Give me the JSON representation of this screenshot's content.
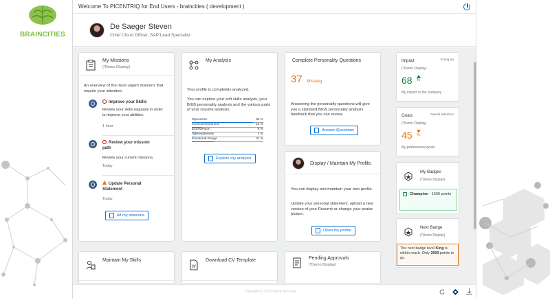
{
  "app": {
    "title": "Welcome To PICENTRIQ for End Users - braincities ( development )",
    "brand": "BRAINCITIES",
    "copyright": "Copyright © 2020 BrainCities Lab"
  },
  "user": {
    "name": "De Saeger Steven",
    "role": "Chief Cloud Officer, SAP Lead Specialist"
  },
  "missions": {
    "title": "My Missions",
    "subtitle": "(*Demo Display)",
    "intro": "An overview of the most urgent missions that require your attention:",
    "items": [
      {
        "title": "Improve your Skills",
        "desc": "Review your skills regularly in order to improve your abilities.",
        "time": "1 hour"
      },
      {
        "title": "Review your mission path",
        "desc": "Review your current missions.",
        "time": "Today"
      },
      {
        "title": "Update Personal Statement",
        "desc": "",
        "time": "Today"
      }
    ],
    "button": "All my missions"
  },
  "analysis": {
    "title": "My Analysis",
    "status": "Your profile is completely analyzed.",
    "desc": "You can explore your soft skills analysis, your BIG5 personality analysis and the various parts of your resume analysis.",
    "traits": [
      {
        "label": "Openness",
        "value": "86 %",
        "pct": 86
      },
      {
        "label": "Conscientiousness",
        "value": "14 %",
        "pct": 14
      },
      {
        "label": "Extraversion",
        "value": "6 %",
        "pct": 6
      },
      {
        "label": "Agreeableness",
        "value": "1 %",
        "pct": 1
      },
      {
        "label": "Emotional Range",
        "value": "31 %",
        "pct": 31
      }
    ],
    "button": "Explore my analysis"
  },
  "personality": {
    "title": "Complete Personality Questions",
    "count": "37",
    "count_label": "Missing",
    "desc": "Answering the personality questions will give you a standard BIG5 personality analysis feedback that you can review.",
    "button": "Answer Questions"
  },
  "display_profile": {
    "title": "Display / Maintain My Profile.",
    "desc1": "You can display and maintain your own profile.",
    "desc2": "Update your personal statement, upload a new version of your Resumé or change your avatar picture.",
    "button": "Open my profile"
  },
  "impact": {
    "title": "Impact",
    "status": "Going up",
    "subtitle": "(*Demo Display)",
    "value": "68",
    "unit": "%",
    "footer": "My impact in the company",
    "color": "#107e3e"
  },
  "goals": {
    "title": "Goals",
    "status": "Needs attention",
    "subtitle": "(*Demo Display)",
    "value": "45",
    "unit": "%",
    "footer": "My professional goals",
    "color": "#e9730c"
  },
  "badges": {
    "title": "My Badges",
    "subtitle": "(*Demo Display)",
    "badge_name": "Champion",
    "badge_points": "- 1500 points"
  },
  "next_badge": {
    "title": "Next Badge",
    "subtitle": "(*Demo Display)",
    "text_pre": "The next badge level ",
    "level": "King",
    "text_mid": " is within reach. Only ",
    "points": "3500",
    "text_post": " points to go."
  },
  "bottom_cards": {
    "skills": "Maintain My Skills",
    "cv": "Download CV Template",
    "approvals": "Pending Approvals",
    "approvals_sub": "(*Demo Display)"
  }
}
